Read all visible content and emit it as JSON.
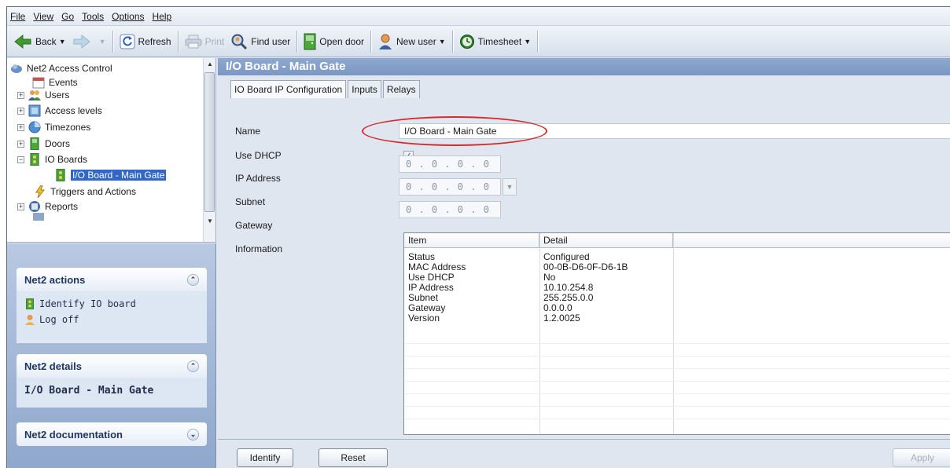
{
  "menubar": {
    "items": [
      "File",
      "View",
      "Go",
      "Tools",
      "Options",
      "Help"
    ]
  },
  "toolbar": {
    "back": "Back",
    "refresh": "Refresh",
    "print": "Print",
    "find_user": "Find user",
    "open_door": "Open door",
    "new_user": "New user",
    "timesheet": "Timesheet"
  },
  "tree": {
    "root": "Net2 Access Control",
    "items": [
      "Events",
      "Users",
      "Access levels",
      "Timezones",
      "Doors",
      "IO Boards"
    ],
    "selected": "I/O Board - Main Gate",
    "triggers": "Triggers and Actions",
    "reports": "Reports"
  },
  "panels": {
    "actions_title": "Net2 actions",
    "actions": [
      "Identify IO board",
      "Log off"
    ],
    "details_title": "Net2 details",
    "details_value": "I/O Board - Main Gate",
    "documentation_title": "Net2 documentation"
  },
  "main": {
    "title": "I/O Board - Main Gate",
    "tabs": [
      "IO Board IP Configuration",
      "Inputs",
      "Relays"
    ],
    "labels": {
      "name": "Name",
      "use_dhcp": "Use DHCP",
      "ip_address": "IP Address",
      "subnet": "Subnet",
      "gateway": "Gateway",
      "information": "Information"
    },
    "name_value": "I/O Board - Main Gate",
    "use_dhcp_checked": true,
    "ip_address_value": "0 . 0 . 0 . 0",
    "subnet_value": "0 . 0 . 0 . 0",
    "gateway_value": "0 . 0 . 0 . 0",
    "info_headers": [
      "Item",
      "Detail"
    ],
    "info_rows": [
      [
        "Status",
        "Configured"
      ],
      [
        "MAC Address",
        "00-0B-D6-0F-D6-1B"
      ],
      [
        "Use DHCP",
        "No"
      ],
      [
        "IP Address",
        "10.10.254.8"
      ],
      [
        "Subnet",
        "255.255.0.0"
      ],
      [
        "Gateway",
        "0.0.0.0"
      ],
      [
        "Version",
        "1.2.0025"
      ]
    ],
    "buttons": {
      "identify": "Identify",
      "reset": "Reset",
      "apply": "Apply"
    }
  },
  "colors": {
    "title_bar": "#7b97c3",
    "selection": "#3168c6",
    "highlight_ellipse": "#d52b2b"
  }
}
